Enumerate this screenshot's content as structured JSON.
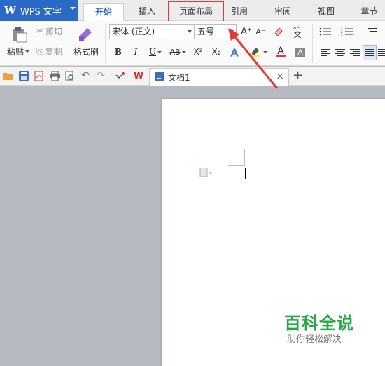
{
  "app": {
    "logo": "W",
    "title": "WPS 文字"
  },
  "tabs": [
    {
      "label": "开始",
      "active": true
    },
    {
      "label": "插入"
    },
    {
      "label": "页面布局",
      "highlighted": true
    },
    {
      "label": "引用"
    },
    {
      "label": "审阅"
    },
    {
      "label": "视图"
    },
    {
      "label": "章节"
    }
  ],
  "ribbon": {
    "paste_label": "粘贴",
    "cut_label": "剪切",
    "copy_label": "复制",
    "format_painter_label": "格式刷",
    "font_name": "宋体 (正文)",
    "font_size": "五号",
    "bold": "B",
    "italic": "I",
    "underline": "U",
    "strikethrough": "AB",
    "superscript": "X²",
    "subscript": "X₂",
    "grow_font": "A⁺",
    "shrink_font": "A⁻",
    "phonetic_top": "wén",
    "phonetic_char": "文",
    "font_color_letter": "A",
    "char_shading_letter": "A"
  },
  "document_tab": {
    "label": "文档1",
    "close": "×"
  },
  "new_tab": "+",
  "watermark": {
    "title": "百科全说",
    "subtitle": "助你轻松解决"
  },
  "colors": {
    "accent": "#2b69c6",
    "highlight_box": "#e53935",
    "watermark_green": "#27a844",
    "workspace_bg": "#b6bac1"
  }
}
